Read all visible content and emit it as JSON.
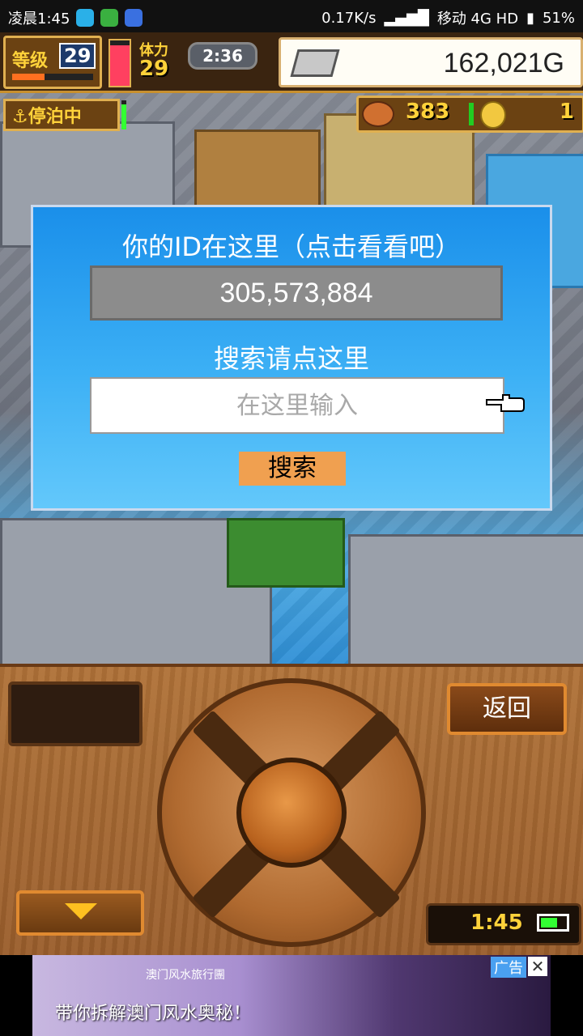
{
  "status_bar": {
    "time": "凌晨1:45",
    "speed": "0.17K/s",
    "carrier": "移动 4G HD",
    "battery": "51%"
  },
  "hud": {
    "level_label": "等级",
    "level_value": "29",
    "level_progress": 0.4,
    "hp_fill": 0.9,
    "stamina_label": "体力",
    "stamina_value": "29",
    "clock": "2:36",
    "gold": "162,021G",
    "mooring_label": "停泊中",
    "food_value": "383",
    "coin_value": "1"
  },
  "dialog": {
    "title": "你的ID在这里（点击看看吧）",
    "id_value": "305,573,884",
    "search_label": "搜索请点这里",
    "search_placeholder": "在这里输入",
    "search_button": "搜索"
  },
  "controller": {
    "back_button": "返回",
    "game_time": "1:45"
  },
  "ad": {
    "brand": "澳门风水旅行團",
    "text": "带你拆解澳门风水奥秘！",
    "tag": "广告",
    "close": "✕"
  }
}
